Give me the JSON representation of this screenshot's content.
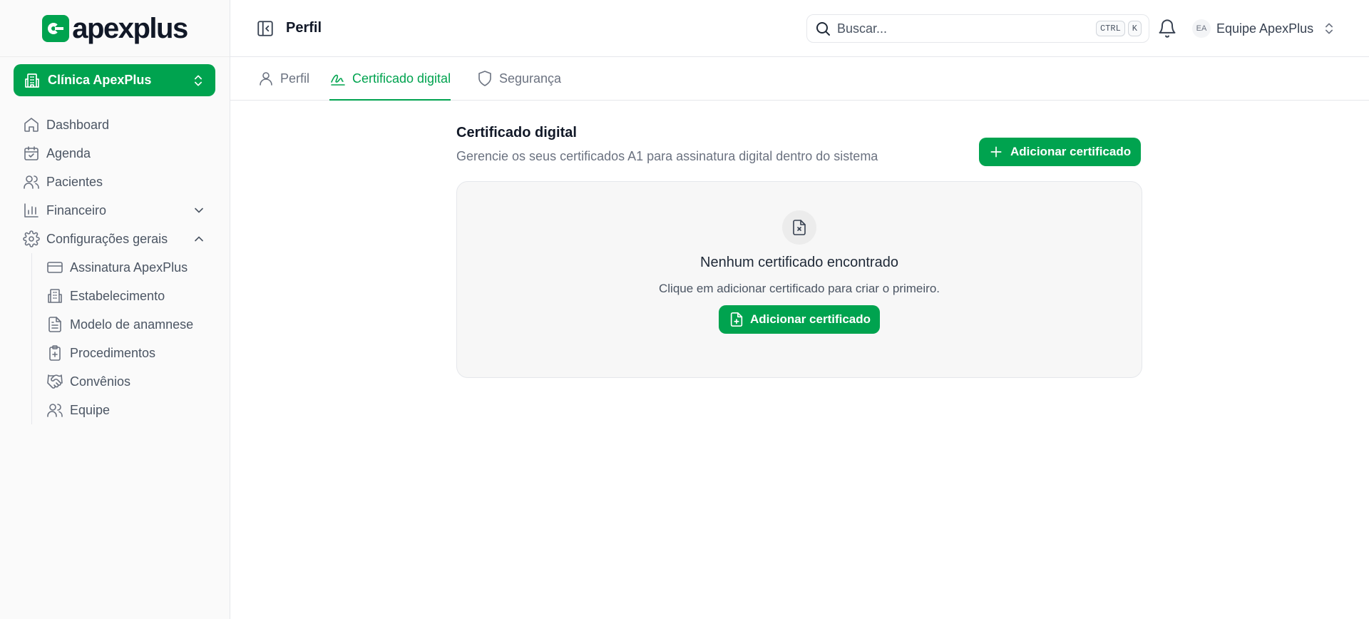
{
  "brand": {
    "name": "apexplus",
    "accent": "#00a34f"
  },
  "sidebar": {
    "clinic_selector": {
      "label": "Clínica ApexPlus",
      "icon": "building-icon"
    },
    "items": [
      {
        "label": "Dashboard",
        "icon": "home-icon"
      },
      {
        "label": "Agenda",
        "icon": "calendar-check-icon"
      },
      {
        "label": "Pacientes",
        "icon": "users-icon"
      },
      {
        "label": "Financeiro",
        "icon": "bar-chart-icon",
        "expanded": false
      },
      {
        "label": "Configurações gerais",
        "icon": "gear-icon",
        "expanded": true
      }
    ],
    "subitems": [
      {
        "label": "Assinatura ApexPlus",
        "icon": "credit-card-icon"
      },
      {
        "label": "Estabelecimento",
        "icon": "building-icon"
      },
      {
        "label": "Modelo de anamnese",
        "icon": "file-text-icon"
      },
      {
        "label": "Procedimentos",
        "icon": "clipboard-plus-icon"
      },
      {
        "label": "Convênios",
        "icon": "handshake-icon"
      },
      {
        "label": "Equipe",
        "icon": "users-icon"
      }
    ]
  },
  "header": {
    "title": "Perfil",
    "search": {
      "placeholder": "Buscar...",
      "shortcut_mod": "CTRL",
      "shortcut_key": "K"
    },
    "team": {
      "avatar": "EA",
      "label": "Equipe ApexPlus"
    }
  },
  "tabs": [
    {
      "label": "Perfil",
      "icon": "user-icon",
      "active": false
    },
    {
      "label": "Certificado digital",
      "icon": "signature-icon",
      "active": true
    },
    {
      "label": "Segurança",
      "icon": "shield-icon",
      "active": false
    }
  ],
  "section": {
    "title": "Certificado digital",
    "subtitle": "Gerencie os seus certificados A1 para assinatura digital dentro do sistema",
    "add_button": "Adicionar certificado"
  },
  "empty_state": {
    "title": "Nenhum certificado encontrado",
    "message": "Clique em adicionar certificado para criar o primeiro.",
    "button": "Adicionar certificado"
  }
}
